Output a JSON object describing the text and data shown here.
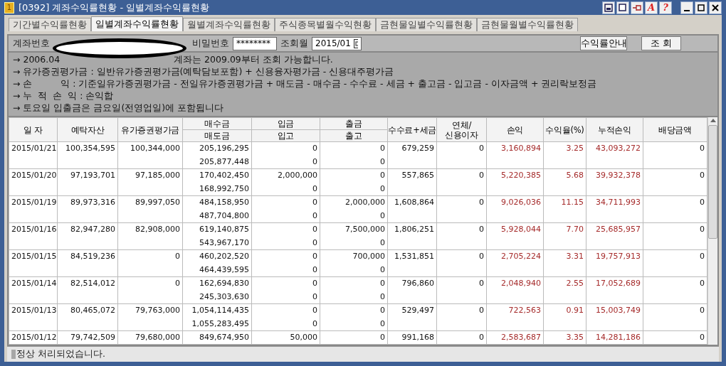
{
  "window": {
    "number_badge": "1",
    "title": "[0392] 계좌수익률현황 - 일별계좌수익률현황",
    "tool_chars": {
      "font": "A",
      "help": "?"
    }
  },
  "tabs": [
    {
      "label": "기간별수익률현황",
      "selected": false
    },
    {
      "label": "일별계좌수익률현황",
      "selected": true
    },
    {
      "label": "월별계좌수익률현황",
      "selected": false
    },
    {
      "label": "주식종목별월수익현황",
      "selected": false
    },
    {
      "label": "금현물일별수익률현황",
      "selected": false
    },
    {
      "label": "금현물월별수익률현황",
      "selected": false
    }
  ],
  "form": {
    "account_label": "계좌번호",
    "password_label": "비밀번호",
    "password_value": "********",
    "month_label": "조회월",
    "month_value": "2015/01",
    "guide_button": "수익률안내",
    "query_button": "조 회"
  },
  "notes": {
    "first_line": {
      "start": "→ 2006.04",
      "end": "계좌는 2009.09부터 조회 가능합니다."
    },
    "lines": [
      "→ 유가증권평가금 : 일반유가증권평가금(예탁담보포함) + 신용융자평가금 - 신용대주평가금",
      "→ 손          익 : 기준일유가증권평가금 - 전일유가증권평가금 + 매도금 - 매수금 - 수수료 - 세금 + 출고금 - 입고금 - 이자금액 + 권리락보정금",
      "→ 누  적  손  익 : 손익합",
      "→ 토요일 입출금은 금요일(전영업일)에 포함됩니다"
    ]
  },
  "table": {
    "columns": [
      {
        "top": "일 자"
      },
      {
        "top": "예탁자산"
      },
      {
        "top": "유가증권평가금"
      },
      {
        "top": "매수금",
        "bottom": "매도금"
      },
      {
        "top": "입금",
        "bottom": "입고"
      },
      {
        "top": "출금",
        "bottom": "출고"
      },
      {
        "top": "수수료+세금"
      },
      {
        "top": "연체/",
        "bottom": "신용이자"
      },
      {
        "top": "손익"
      },
      {
        "top": "수익율(%)"
      },
      {
        "top": "누적손익"
      },
      {
        "top": "배당금액"
      }
    ],
    "rows": [
      {
        "date": "2015/01/21",
        "deposit": "100,354,595",
        "securities": "100,344,000",
        "buy": "205,196,295",
        "sell": "205,877,448",
        "cash_in": "0",
        "stock_in": "0",
        "cash_out": "0",
        "stock_out": "0",
        "fee_tax": "679,259",
        "interest": "0",
        "profit": "3,160,894",
        "rate": "3.25",
        "cumulative": "43,093,272",
        "dividend": "0"
      },
      {
        "date": "2015/01/20",
        "deposit": "97,193,701",
        "securities": "97,185,000",
        "buy": "170,402,450",
        "sell": "168,992,750",
        "cash_in": "2,000,000",
        "stock_in": "0",
        "cash_out": "0",
        "stock_out": "0",
        "fee_tax": "557,865",
        "interest": "0",
        "profit": "5,220,385",
        "rate": "5.68",
        "cumulative": "39,932,378",
        "dividend": "0"
      },
      {
        "date": "2015/01/19",
        "deposit": "89,973,316",
        "securities": "89,997,050",
        "buy": "484,158,950",
        "sell": "487,704,800",
        "cash_in": "0",
        "stock_in": "0",
        "cash_out": "2,000,000",
        "stock_out": "0",
        "fee_tax": "1,608,864",
        "interest": "0",
        "profit": "9,026,036",
        "rate": "11.15",
        "cumulative": "34,711,993",
        "dividend": "0"
      },
      {
        "date": "2015/01/16",
        "deposit": "82,947,280",
        "securities": "82,908,000",
        "buy": "619,140,875",
        "sell": "543,967,170",
        "cash_in": "0",
        "stock_in": "0",
        "cash_out": "7,500,000",
        "stock_out": "0",
        "fee_tax": "1,806,251",
        "interest": "0",
        "profit": "5,928,044",
        "rate": "7.70",
        "cumulative": "25,685,957",
        "dividend": "0"
      },
      {
        "date": "2015/01/15",
        "deposit": "84,519,236",
        "securities": "0",
        "buy": "460,202,520",
        "sell": "464,439,595",
        "cash_in": "0",
        "stock_in": "0",
        "cash_out": "700,000",
        "stock_out": "0",
        "fee_tax": "1,531,851",
        "interest": "0",
        "profit": "2,705,224",
        "rate": "3.31",
        "cumulative": "19,757,913",
        "dividend": "0"
      },
      {
        "date": "2015/01/14",
        "deposit": "82,514,012",
        "securities": "0",
        "buy": "162,694,830",
        "sell": "245,303,630",
        "cash_in": "0",
        "stock_in": "0",
        "cash_out": "0",
        "stock_out": "0",
        "fee_tax": "796,860",
        "interest": "0",
        "profit": "2,048,940",
        "rate": "2.55",
        "cumulative": "17,052,689",
        "dividend": "0"
      },
      {
        "date": "2015/01/13",
        "deposit": "80,465,072",
        "securities": "79,763,000",
        "buy": "1,054,114,435",
        "sell": "1,055,283,495",
        "cash_in": "0",
        "stock_in": "0",
        "cash_out": "0",
        "stock_out": "0",
        "fee_tax": "529,497",
        "interest": "0",
        "profit": "722,563",
        "rate": "0.91",
        "cumulative": "15,003,749",
        "dividend": "0"
      },
      {
        "date": "2015/01/12",
        "deposit": "79,742,509",
        "securities": "79,680,000",
        "buy": "849,674,950",
        "cash_in": "50,000",
        "cash_out": "0",
        "fee_tax": "991,168",
        "interest": "0",
        "profit": "2,583,687",
        "rate": "3.35",
        "cumulative": "14,281,186",
        "dividend": "0"
      }
    ]
  },
  "status_bar": {
    "message": "정상 처리되었습니다."
  }
}
